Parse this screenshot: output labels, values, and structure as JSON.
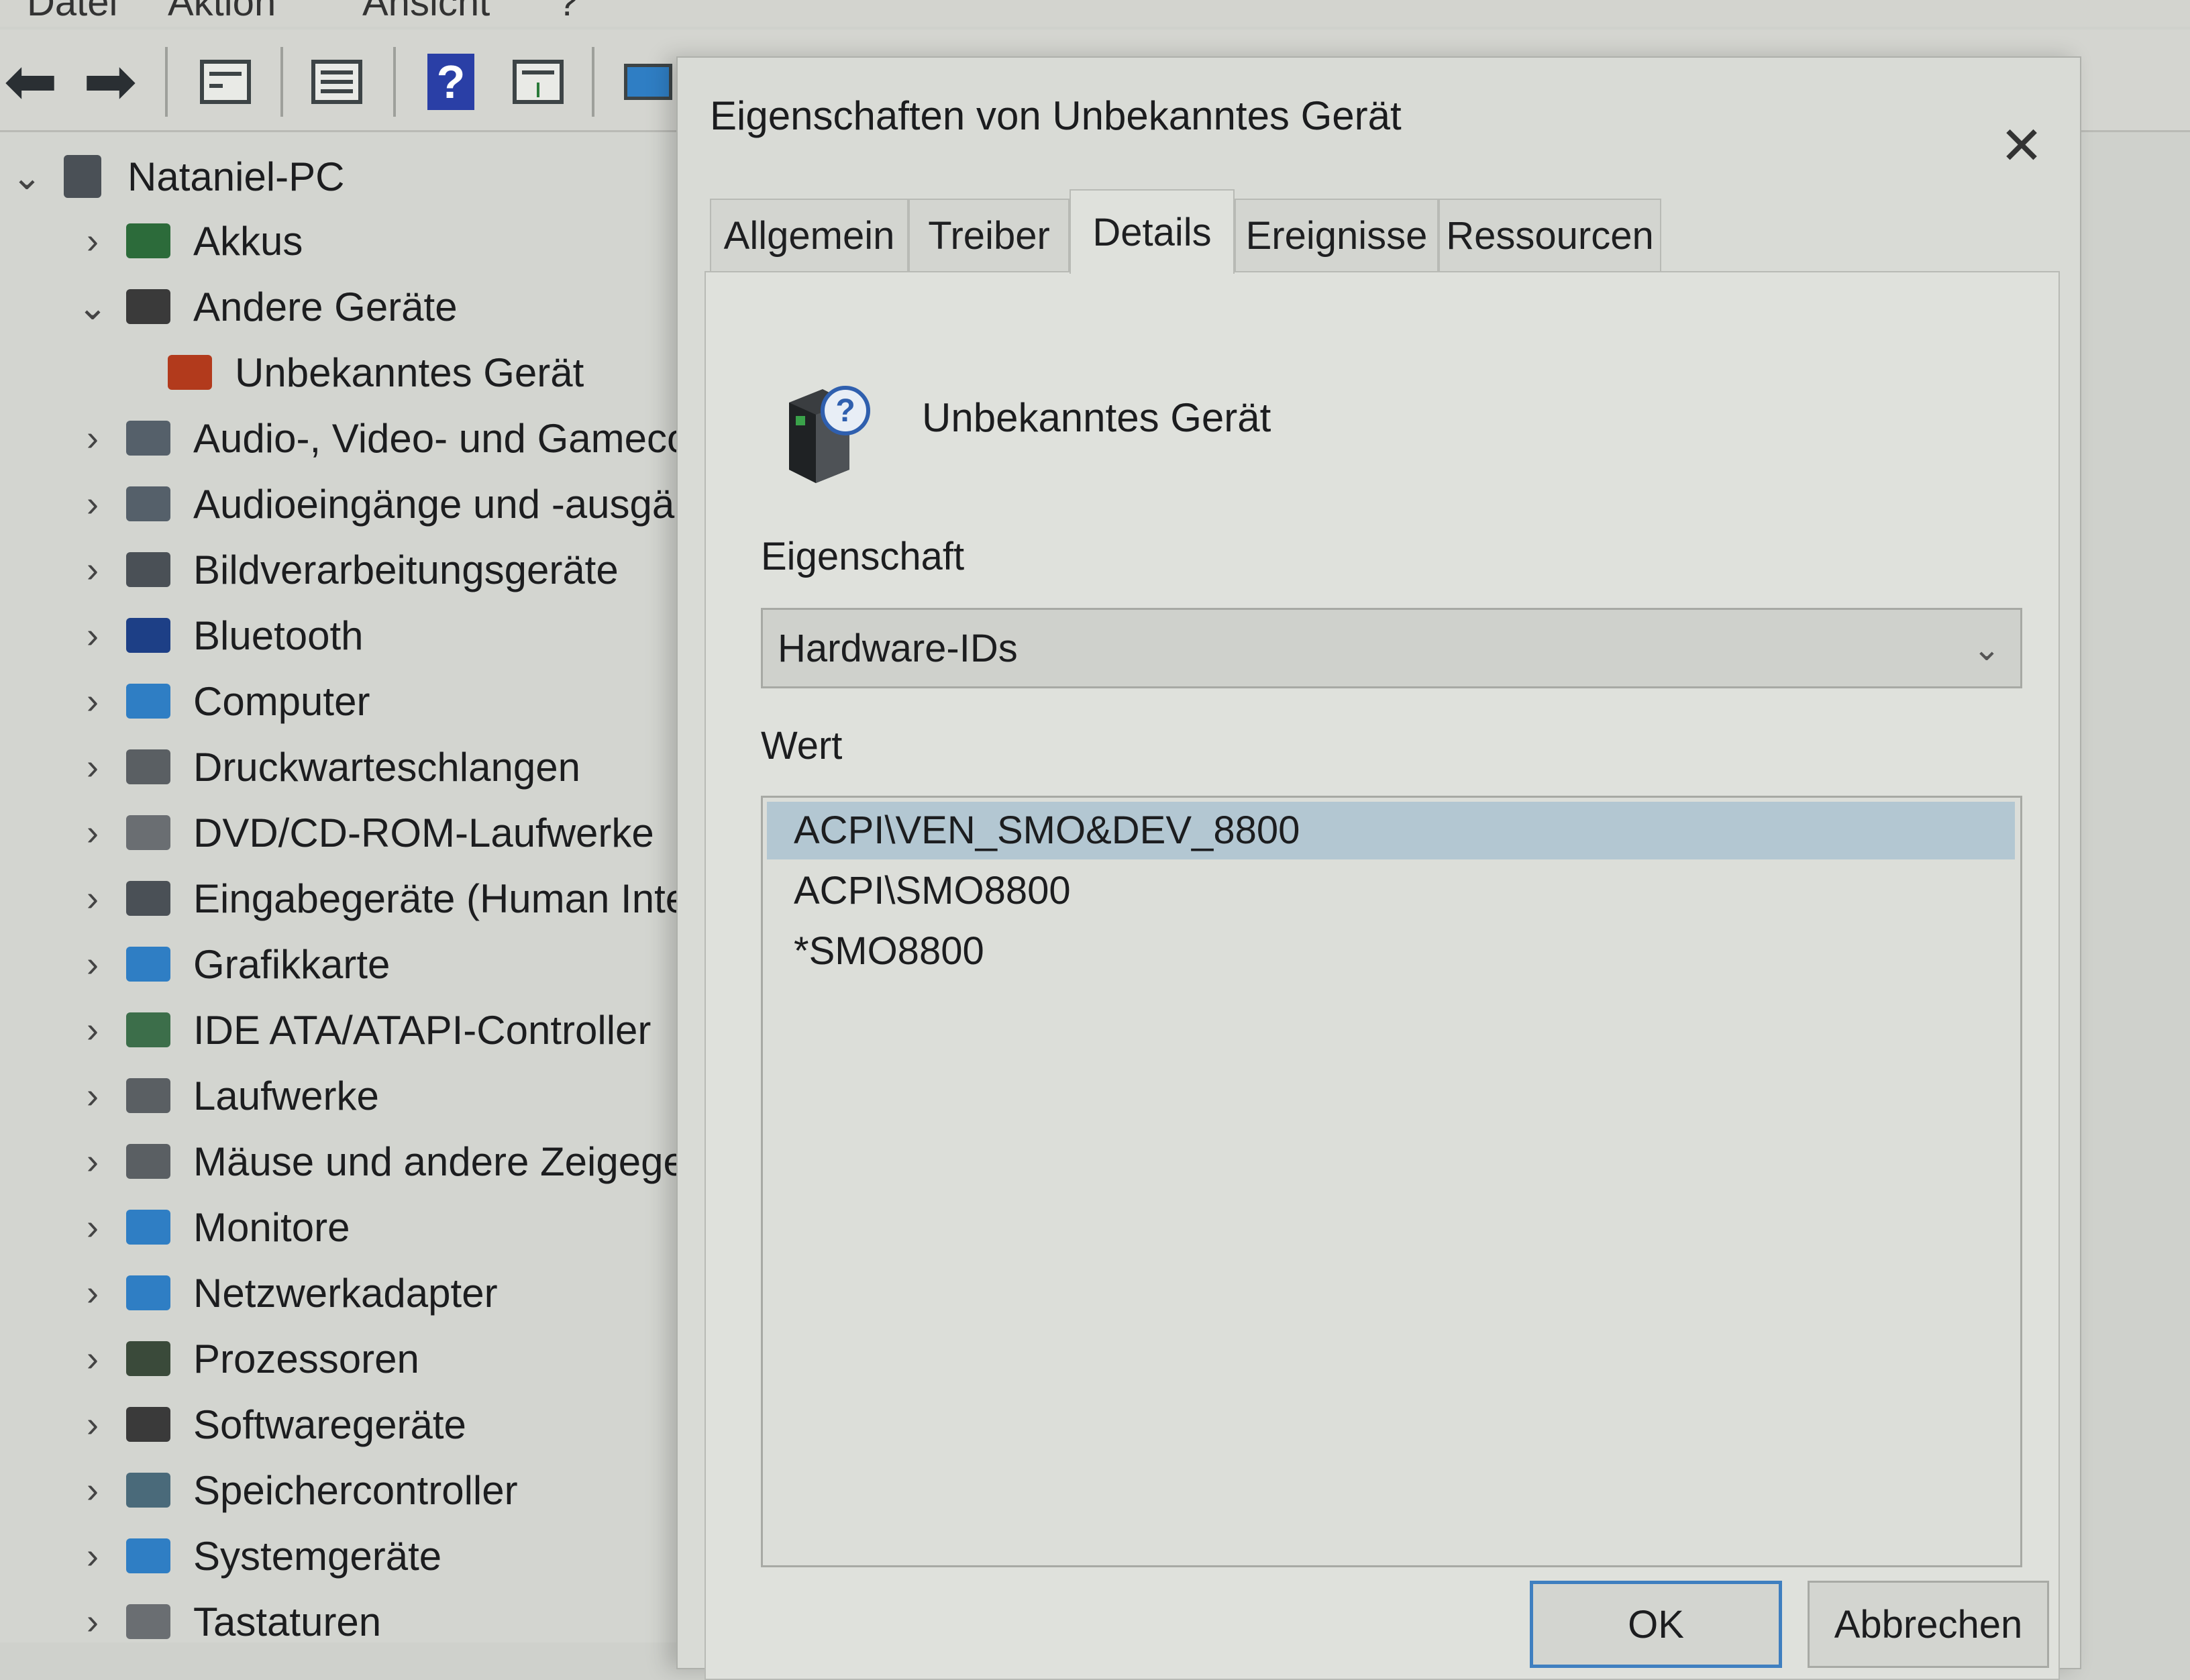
{
  "menubar": {
    "items": [
      "Datei",
      "Aktion",
      "Ansicht",
      "?"
    ]
  },
  "toolbar": {
    "icons": [
      "back-arrow-icon",
      "forward-arrow-icon",
      "console-tree-icon",
      "properties-icon",
      "help-icon",
      "run-icon",
      "monitor-icon"
    ]
  },
  "tree": {
    "root": "Nataniel-PC",
    "items": [
      {
        "label": "Akkus",
        "icon": "battery-icon",
        "color": "#2c6b3a"
      },
      {
        "label": "Andere Geräte",
        "icon": "other-devices-icon",
        "color": "#3a3a3a"
      },
      {
        "label": "Unbekanntes Gerät",
        "icon": "unknown-device-warning-icon",
        "color": "#b23a1c"
      },
      {
        "label": "Audio-, Video- und Gamecontroller",
        "icon": "speaker-icon",
        "color": "#55606a"
      },
      {
        "label": "Audioeingänge und -ausgänge",
        "icon": "speaker-icon",
        "color": "#55606a"
      },
      {
        "label": "Bildverarbeitungsgeräte",
        "icon": "camera-icon",
        "color": "#4a5056"
      },
      {
        "label": "Bluetooth",
        "icon": "bluetooth-icon",
        "color": "#1d3f86"
      },
      {
        "label": "Computer",
        "icon": "computer-icon",
        "color": "#2f7ec4"
      },
      {
        "label": "Druckwarteschlangen",
        "icon": "printer-icon",
        "color": "#5a5f63"
      },
      {
        "label": "DVD/CD-ROM-Laufwerke",
        "icon": "dvd-drive-icon",
        "color": "#6a6e72"
      },
      {
        "label": "Eingabegeräte (Human Interface Devices)",
        "icon": "keyboard-hid-icon",
        "color": "#4a5056"
      },
      {
        "label": "Grafikkarte",
        "icon": "display-adapter-icon",
        "color": "#2f7ec4"
      },
      {
        "label": "IDE ATA/ATAPI-Controller",
        "icon": "ide-controller-icon",
        "color": "#3c6e4a"
      },
      {
        "label": "Laufwerke",
        "icon": "disk-drive-icon",
        "color": "#5a5f63"
      },
      {
        "label": "Mäuse und andere Zeigegeräte",
        "icon": "mouse-icon",
        "color": "#5a5f63"
      },
      {
        "label": "Monitore",
        "icon": "monitor-icon",
        "color": "#2f7ec4"
      },
      {
        "label": "Netzwerkadapter",
        "icon": "network-adapter-icon",
        "color": "#2f7ec4"
      },
      {
        "label": "Prozessoren",
        "icon": "processor-icon",
        "color": "#3a4a3a"
      },
      {
        "label": "Softwaregeräte",
        "icon": "software-device-icon",
        "color": "#3a3a3a"
      },
      {
        "label": "Speichercontroller",
        "icon": "storage-controller-icon",
        "color": "#4a6a7a"
      },
      {
        "label": "Systemgeräte",
        "icon": "folder-icon",
        "color": "#2f7ec4"
      },
      {
        "label": "Tastaturen",
        "icon": "keyboard-icon",
        "color": "#6a6e72"
      }
    ]
  },
  "dialog": {
    "title": "Eigenschaften von Unbekanntes Gerät",
    "close_glyph": "✕",
    "tabs": [
      {
        "label": "Allgemein",
        "active": false
      },
      {
        "label": "Treiber",
        "active": false
      },
      {
        "label": "Details",
        "active": true
      },
      {
        "label": "Ereignisse",
        "active": false
      },
      {
        "label": "Ressourcen",
        "active": false
      }
    ],
    "device_name": "Unbekanntes Gerät",
    "property_label": "Eigenschaft",
    "property_value": "Hardware-IDs",
    "value_label": "Wert",
    "values": [
      "ACPI\\VEN_SMO&DEV_8800",
      "ACPI\\SMO8800",
      "*SMO8800"
    ],
    "selected_index": 0,
    "ok_label": "OK",
    "cancel_label": "Abbrechen"
  },
  "colors": {
    "selection": "#b3c7d2",
    "ok_focus_border": "#3f7fc0",
    "help_blue": "#2a3fa6"
  }
}
